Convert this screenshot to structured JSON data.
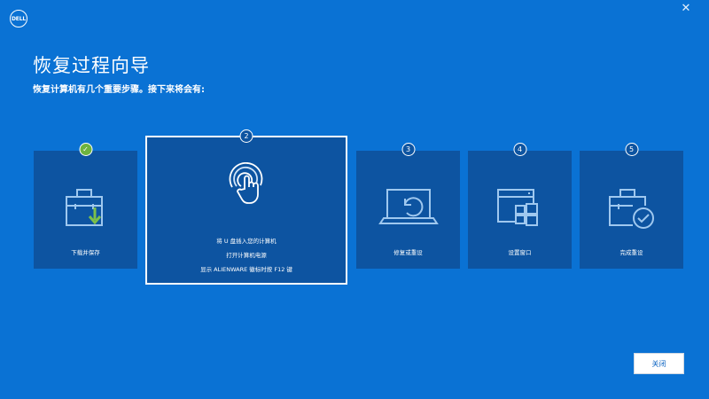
{
  "header": {
    "logo_text": "DELL",
    "close_glyph": "✕"
  },
  "title": "恢复过程向导",
  "subtitle": "恢复计算机有几个重要步骤。接下来将会有:",
  "steps": [
    {
      "badge": "✓",
      "status": "done",
      "label": "下载并保存",
      "icon": "toolbox-download-icon"
    },
    {
      "badge": "2",
      "status": "active",
      "icon": "touch-click-icon",
      "lines": [
        "将 U 盘插入您的计算机",
        "打开计算机电源",
        "显示 ALIENWARE 徽标时按 F12 键"
      ]
    },
    {
      "badge": "3",
      "status": "pending",
      "label": "修复或重设",
      "icon": "laptop-restore-icon"
    },
    {
      "badge": "4",
      "status": "pending",
      "label": "设置窗口",
      "icon": "windows-setup-icon"
    },
    {
      "badge": "5",
      "status": "pending",
      "label": "完成重设",
      "icon": "toolbox-check-icon"
    }
  ],
  "footer": {
    "close_label": "关闭"
  },
  "colors": {
    "background": "#0a72d4",
    "card": "#0d54a1",
    "done": "#6db33f",
    "icon": "#9fc8ef"
  }
}
